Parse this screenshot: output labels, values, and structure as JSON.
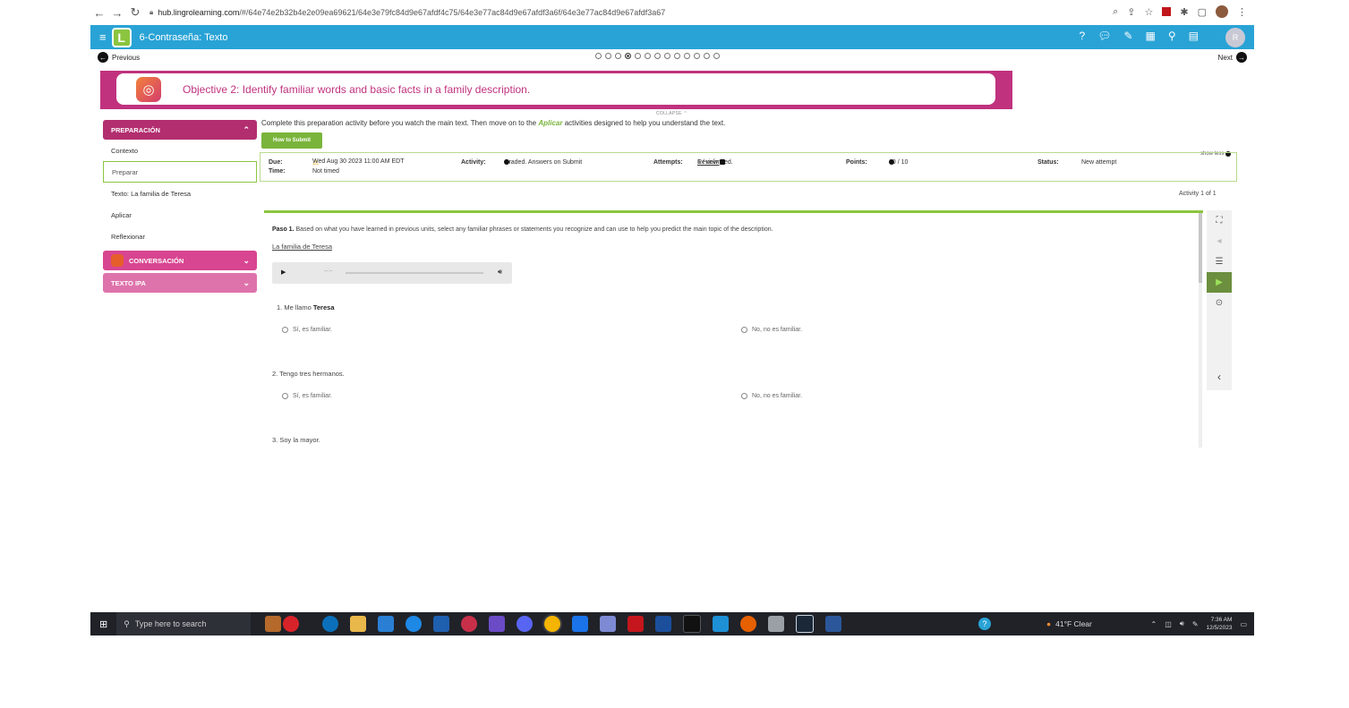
{
  "browser": {
    "url_host": "hub.lingrolearning.com",
    "url_path": "/#/64e74e2b32b4e2e09ea69621/64e3e79fc84d9e67afdf4c75/64e3e77ac84d9e67afdf3a6f/64e3e77ac84d9e67afdf3a67"
  },
  "header": {
    "title": "6-Contraseña: Texto",
    "avatar_initial": "R"
  },
  "pager": {
    "prev_label": "Previous",
    "next_label": "Next",
    "dot_count": 13,
    "active_dot": 4
  },
  "objective": {
    "text": "Objective 2: Identify familiar words and basic facts in a family description.",
    "collapse_label": "COLLAPSE ⌃"
  },
  "sidebar": {
    "section_prep": "PREPARACIÓN",
    "items": [
      "Contexto",
      "Preparar",
      "Texto: La familia de Teresa",
      "Aplicar",
      "Reflexionar"
    ],
    "active_item": "Preparar",
    "section_conv": "CONVERSACIÓN",
    "section_texto": "TEXTO IPA"
  },
  "main": {
    "intro_before": "Complete this preparation activity before you watch the main text. Then move on to the ",
    "intro_link": "Aplicar",
    "intro_after": " activities designed to help you understand the text.",
    "how_to_submit": "How to Submit",
    "show_less": "show less",
    "info": {
      "due_label": "Due:",
      "due_value": "Wed Aug 30 2023 11:00 AM EDT",
      "time_label": "Time:",
      "time_value": "Not timed",
      "activity_label": "Activity:",
      "activity_value": "Graded. Answers on Submit",
      "attempts_label": "Attempts:",
      "attempts_value": "1 / unlimited.",
      "review_label": "Review.",
      "points_label": "Points:",
      "points_value": "10 / 10",
      "status_label": "Status:",
      "status_value": "New attempt"
    },
    "activity_count": "Activity 1 of 1"
  },
  "activity": {
    "paso_bold": "Paso 1.",
    "paso_text": " Based on what you have learned in previous units, select any familiar phrases or statements you recognize and can use to help you predict the main topic of the description.",
    "title_link": "La familia de Teresa",
    "audio_time": "--:--",
    "questions": [
      {
        "text": "1. Me llamo ",
        "bold": "Teresa",
        "opt_yes": "Sí, es familiar.",
        "opt_no": "No, no es familiar."
      },
      {
        "text": "2. Tengo tres hermanos.",
        "bold": "",
        "opt_yes": "Sí, es familiar.",
        "opt_no": "No, no es familiar."
      },
      {
        "text": "3. Soy la mayor.",
        "bold": "",
        "opt_yes": "",
        "opt_no": ""
      }
    ]
  },
  "taskbar": {
    "search_placeholder": "Type here to search",
    "weather": "41°F  Clear",
    "time": "7:36 AM",
    "date": "12/5/2023"
  },
  "colors": {
    "header_blue": "#29a3d6",
    "brand_magenta": "#c0327e",
    "accent_green": "#8bc53f"
  }
}
